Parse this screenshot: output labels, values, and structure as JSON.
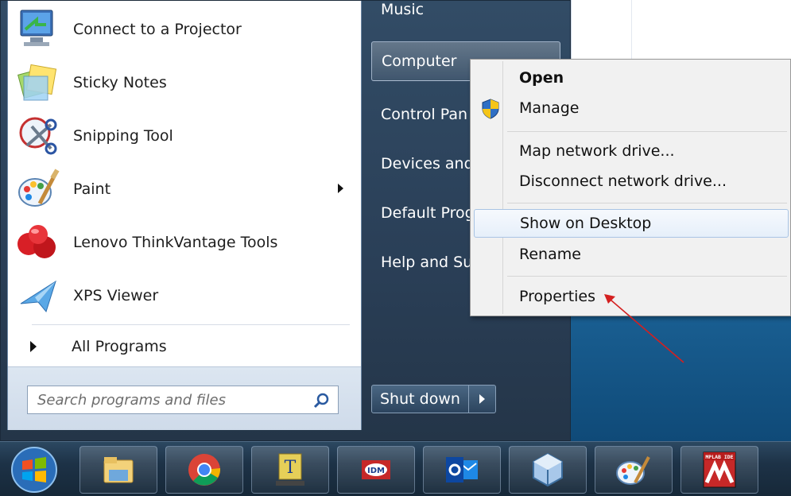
{
  "programs": [
    {
      "label": "Connect to a Projector",
      "icon": "projector-icon"
    },
    {
      "label": "Sticky Notes",
      "icon": "sticky-notes-icon"
    },
    {
      "label": "Snipping Tool",
      "icon": "scissors-icon"
    },
    {
      "label": "Paint",
      "icon": "paint-palette-icon",
      "has_submenu": true
    },
    {
      "label": "Lenovo ThinkVantage Tools",
      "icon": "thinkvantage-icon"
    },
    {
      "label": "XPS Viewer",
      "icon": "xps-viewer-icon"
    }
  ],
  "all_programs_label": "All Programs",
  "search": {
    "placeholder": "Search programs and files"
  },
  "right_pane": {
    "music": "Music",
    "computer": "Computer",
    "control_panel": "Control Pan",
    "devices": "Devices and",
    "default_programs": "Default Prog",
    "help": "Help and Su"
  },
  "shutdown": {
    "label": "Shut down"
  },
  "context_menu": {
    "open": "Open",
    "manage": "Manage",
    "map_drive": "Map network drive...",
    "disconnect_drive": "Disconnect network drive...",
    "show_desktop": "Show on Desktop",
    "rename": "Rename",
    "properties": "Properties"
  },
  "taskbar": {
    "items": [
      "start-orb-icon",
      "explorer-icon",
      "chrome-icon",
      "typing-tutor-icon",
      "idm-icon",
      "outlook-icon",
      "virtualbox-icon",
      "paint-icon",
      "mplab-icon"
    ],
    "mplab_label": "MPLAB IDE"
  },
  "colors": {
    "annotation_arrow": "#d42020",
    "highlight": "#e6effa"
  }
}
